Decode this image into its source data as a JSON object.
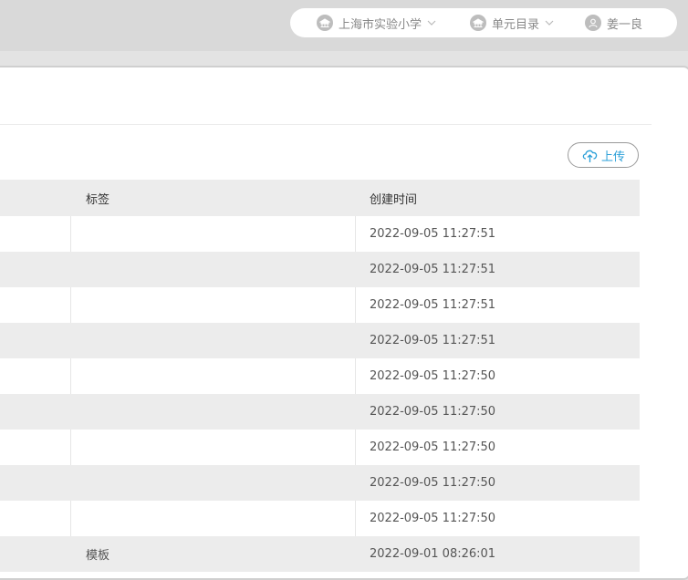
{
  "topbar": {
    "school": "上海市实验小学",
    "unit": "单元目录",
    "user": "姜一良"
  },
  "toolbar": {
    "upload_label": "上传"
  },
  "table": {
    "columns": [
      "标签",
      "创建时间"
    ],
    "rows": [
      {
        "tag": "",
        "created": "2022-09-05 11:27:51"
      },
      {
        "tag": "",
        "created": "2022-09-05 11:27:51"
      },
      {
        "tag": "",
        "created": "2022-09-05 11:27:51"
      },
      {
        "tag": "",
        "created": "2022-09-05 11:27:51"
      },
      {
        "tag": "",
        "created": "2022-09-05 11:27:50"
      },
      {
        "tag": "",
        "created": "2022-09-05 11:27:50"
      },
      {
        "tag": "",
        "created": "2022-09-05 11:27:50"
      },
      {
        "tag": "",
        "created": "2022-09-05 11:27:50"
      },
      {
        "tag": "",
        "created": "2022-09-05 11:27:50"
      },
      {
        "tag": "模板",
        "created": "2022-09-01 08:26:01"
      }
    ]
  },
  "colors": {
    "accent": "#2a9fd8",
    "row_alt": "#ececec"
  },
  "icons": [
    "school-icon",
    "unit-icon",
    "user-icon",
    "chevron-down-icon",
    "cloud-upload-icon"
  ]
}
